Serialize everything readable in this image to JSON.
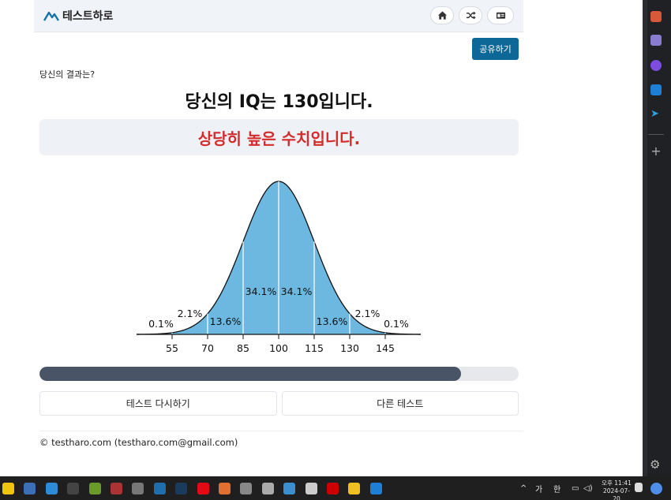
{
  "header": {
    "logo_text": "테스트하로",
    "buttons": [
      {
        "icon": "home-icon"
      },
      {
        "icon": "shuffle-icon"
      },
      {
        "icon": "id-card-icon"
      }
    ]
  },
  "share_label": "공유하기",
  "result_question": "당신의 결과는?",
  "iq_title": "당신의 IQ는 130입니다.",
  "verdict": "상당히 높은 수치입니다.",
  "colors": {
    "accent": "#0d6797",
    "verdict": "#d42c2c",
    "curve_fill": "#6cb8e0",
    "progress": "#495566"
  },
  "chart_data": {
    "type": "area",
    "x_ticks": [
      "55",
      "70",
      "85",
      "100",
      "115",
      "130",
      "145"
    ],
    "segments": [
      {
        "range": "<55",
        "label": "0.1%"
      },
      {
        "range": "55-70",
        "label": "2.1%"
      },
      {
        "range": "70-85",
        "label": "13.6%"
      },
      {
        "range": "85-100",
        "label": "34.1%"
      },
      {
        "range": "100-115",
        "label": "34.1%"
      },
      {
        "range": "115-130",
        "label": "13.6%"
      },
      {
        "range": "130-145",
        "label": "2.1%"
      },
      {
        "range": ">145",
        "label": "0.1%"
      }
    ]
  },
  "progress": {
    "value_percent": 88
  },
  "actions": {
    "retry_label": "테스트 다시하기",
    "other_label": "다른 테스트"
  },
  "footer": "© testharo.com (testharo.com@gmail.com)",
  "taskbar": {
    "tray_chars": [
      "가",
      "한"
    ],
    "clock_time": "오후 11:41",
    "clock_date": "2024-07-20"
  }
}
